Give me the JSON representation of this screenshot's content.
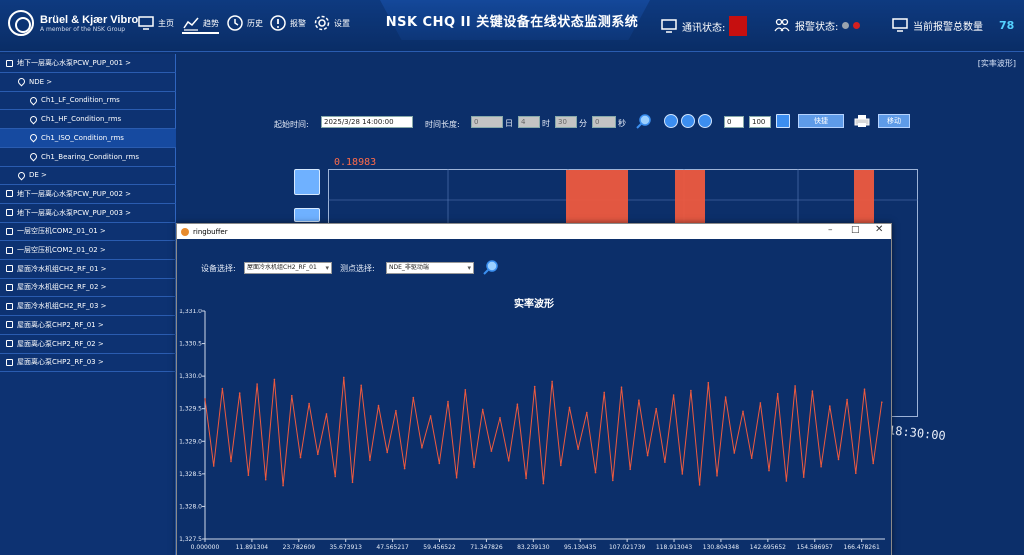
{
  "header": {
    "brand_name": "Brüel & Kjær Vibro",
    "brand_tagline": "A member of the NSK Group",
    "title": "NSK CHQ II 关键设备在线状态监测系统",
    "nav": [
      {
        "label": "主页",
        "icon": "monitor-icon"
      },
      {
        "label": "趋势",
        "icon": "trend-icon"
      },
      {
        "label": "历史",
        "icon": "clock-icon"
      },
      {
        "label": "报警",
        "icon": "alert-icon"
      },
      {
        "label": "设置",
        "icon": "gear-icon"
      }
    ],
    "comm_label": "通讯状态:",
    "alarm_label": "报警状态:",
    "alarm_total_label": "当前报警总数量",
    "alarm_total": "78"
  },
  "colors": {
    "accent": "#0c2f6a",
    "waveform": "#ee5a3f",
    "alarm_red": "#d42020",
    "status_gray": "#9aa3ae"
  },
  "sidebar": {
    "items": [
      {
        "label": "地下一层离心水泵PCW_PUP_001  >",
        "level": 0,
        "icon": "device-icon"
      },
      {
        "label": "NDE  >",
        "level": 1,
        "icon": "location-pin-icon"
      },
      {
        "label": "Ch1_LF_Condition_rms",
        "level": 2,
        "icon": "location-pin-icon"
      },
      {
        "label": "Ch1_HF_Condition_rms",
        "level": 2,
        "icon": "location-pin-icon"
      },
      {
        "label": "Ch1_ISO_Condition_rms",
        "level": 2,
        "icon": "location-pin-icon",
        "selected": true
      },
      {
        "label": "Ch1_Bearing_Condition_rms",
        "level": 2,
        "icon": "location-pin-icon"
      },
      {
        "label": "DE  >",
        "level": 1,
        "icon": "location-pin-icon"
      },
      {
        "label": "地下一层离心水泵PCW_PUP_002  >",
        "level": 0,
        "icon": "device-icon"
      },
      {
        "label": "地下一层离心水泵PCW_PUP_003  >",
        "level": 0,
        "icon": "device-icon"
      },
      {
        "label": "一层空压机COM2_01_01  >",
        "level": 0,
        "icon": "device-icon"
      },
      {
        "label": "一层空压机COM2_01_02  >",
        "level": 0,
        "icon": "device-icon"
      },
      {
        "label": "屋面冷水机组CH2_RF_01  >",
        "level": 0,
        "icon": "device-icon"
      },
      {
        "label": "屋面冷水机组CH2_RF_02  >",
        "level": 0,
        "icon": "device-icon"
      },
      {
        "label": "屋面冷水机组CH2_RF_03  >",
        "level": 0,
        "icon": "device-icon"
      },
      {
        "label": "屋面离心泵CHP2_RF_01  >",
        "level": 0,
        "icon": "device-icon"
      },
      {
        "label": "屋面离心泵CHP2_RF_02  >",
        "level": 0,
        "icon": "device-icon"
      },
      {
        "label": "屋面离心泵CHP2_RF_03  >",
        "level": 0,
        "icon": "device-icon"
      }
    ]
  },
  "main": {
    "view_type": "[实率波形]",
    "start_time_label": "起始时间:",
    "start_time_value": "2025/3/28 14:00:00",
    "duration_label": "时间长度:",
    "duration": [
      {
        "value": "0",
        "unit": "日"
      },
      {
        "value": "4",
        "unit": "时"
      },
      {
        "value": "30",
        "unit": "分"
      },
      {
        "value": "0",
        "unit": "秒"
      }
    ],
    "range_from": "0",
    "range_to": "100",
    "export_button": "快捷",
    "move_button": "移动",
    "bg_chart_max": "0.18983",
    "bg_chart_time_tick": "18:30:00"
  },
  "dialog": {
    "title": "ringbuffer",
    "device_label": "设备选择:",
    "device_value": "屋面冷水机组CH2_RF_01",
    "point_label": "测点选择:",
    "point_value": "NDE_非驱动端"
  },
  "chart_data": {
    "type": "line",
    "title": "实率波形",
    "ylim": [
      1327.5,
      1331.0
    ],
    "y_ticks": [
      "1,331.0",
      "1,330.5",
      "1,330.0",
      "1,329.5",
      "1,329.0",
      "1,328.5",
      "1,328.0",
      "1,327.5"
    ],
    "x_ticks": [
      "0.000000",
      "11.891304",
      "23.782609",
      "35.673913",
      "47.565217",
      "59.456522",
      "71.347826",
      "83.239130",
      "95.130435",
      "107.021739",
      "118.913043",
      "130.804348",
      "142.695652",
      "154.586957",
      "166.478261"
    ],
    "xlim": [
      0,
      172.4
    ],
    "grid": false,
    "series": [
      {
        "color": "#ee5a3f",
        "x": [
          0.0,
          2.2,
          4.4,
          6.6,
          8.8,
          11.0,
          13.2,
          15.4,
          17.6,
          19.8,
          22.0,
          24.2,
          26.4,
          28.6,
          30.8,
          33.0,
          35.2,
          37.4,
          39.6,
          41.8,
          44.0,
          46.2,
          48.4,
          50.6,
          52.8,
          55.0,
          57.2,
          59.4,
          61.6,
          63.8,
          66.0,
          68.2,
          70.4,
          72.6,
          74.8,
          77.0,
          79.2,
          81.4,
          83.6,
          85.8,
          88.0,
          90.2,
          92.4,
          94.6,
          96.8,
          99.0,
          101.2,
          103.4,
          105.6,
          107.8,
          110.0,
          112.2,
          114.4,
          116.6,
          118.8,
          121.0,
          123.2,
          125.4,
          127.6,
          129.8,
          132.0,
          134.2,
          136.4,
          138.6,
          140.8,
          143.0,
          145.2,
          147.4,
          149.6,
          151.8,
          154.0,
          156.2,
          158.4,
          160.6,
          162.8,
          165.0,
          167.2,
          169.4,
          171.6
        ],
        "y": [
          1329.65,
          1328.62,
          1329.81,
          1328.69,
          1329.74,
          1328.48,
          1329.88,
          1328.41,
          1329.95,
          1328.32,
          1329.7,
          1328.75,
          1329.58,
          1328.8,
          1329.42,
          1328.46,
          1329.98,
          1328.37,
          1329.86,
          1328.71,
          1329.55,
          1328.83,
          1329.47,
          1328.58,
          1329.67,
          1328.9,
          1329.39,
          1328.66,
          1329.61,
          1328.44,
          1329.79,
          1328.6,
          1329.49,
          1328.85,
          1329.36,
          1328.7,
          1329.57,
          1328.43,
          1329.84,
          1328.35,
          1329.92,
          1328.63,
          1329.52,
          1328.88,
          1329.44,
          1328.52,
          1329.75,
          1328.4,
          1329.83,
          1328.57,
          1329.63,
          1328.78,
          1329.5,
          1328.68,
          1329.71,
          1328.5,
          1329.78,
          1328.33,
          1329.9,
          1328.47,
          1329.68,
          1328.82,
          1329.46,
          1328.74,
          1329.59,
          1328.55,
          1329.73,
          1328.39,
          1329.85,
          1328.45,
          1329.77,
          1328.61,
          1329.54,
          1328.72,
          1329.64,
          1328.51,
          1329.8,
          1328.66,
          1329.6
        ]
      }
    ]
  }
}
